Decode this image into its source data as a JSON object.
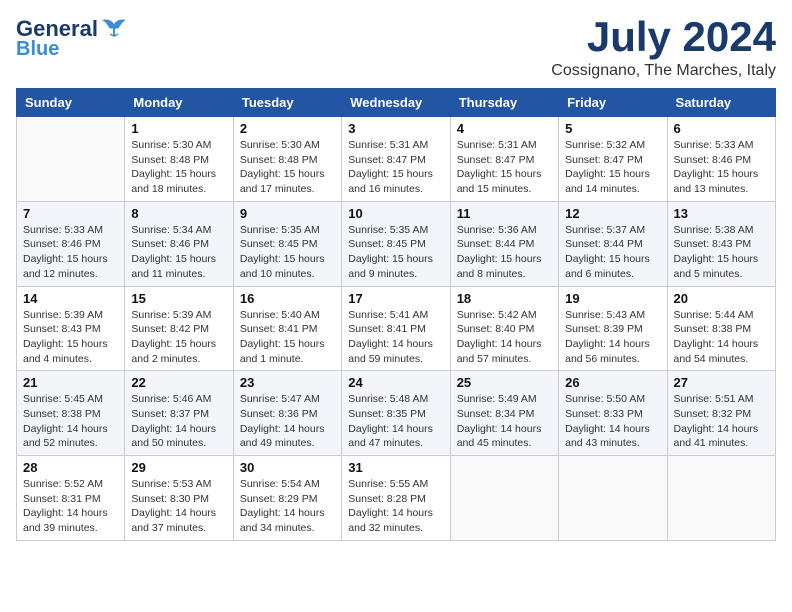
{
  "header": {
    "logo_general": "General",
    "logo_blue": "Blue",
    "month_title": "July 2024",
    "location": "Cossignano, The Marches, Italy"
  },
  "weekdays": [
    "Sunday",
    "Monday",
    "Tuesday",
    "Wednesday",
    "Thursday",
    "Friday",
    "Saturday"
  ],
  "weeks": [
    [
      {
        "day": "",
        "info": ""
      },
      {
        "day": "1",
        "info": "Sunrise: 5:30 AM\nSunset: 8:48 PM\nDaylight: 15 hours\nand 18 minutes."
      },
      {
        "day": "2",
        "info": "Sunrise: 5:30 AM\nSunset: 8:48 PM\nDaylight: 15 hours\nand 17 minutes."
      },
      {
        "day": "3",
        "info": "Sunrise: 5:31 AM\nSunset: 8:47 PM\nDaylight: 15 hours\nand 16 minutes."
      },
      {
        "day": "4",
        "info": "Sunrise: 5:31 AM\nSunset: 8:47 PM\nDaylight: 15 hours\nand 15 minutes."
      },
      {
        "day": "5",
        "info": "Sunrise: 5:32 AM\nSunset: 8:47 PM\nDaylight: 15 hours\nand 14 minutes."
      },
      {
        "day": "6",
        "info": "Sunrise: 5:33 AM\nSunset: 8:46 PM\nDaylight: 15 hours\nand 13 minutes."
      }
    ],
    [
      {
        "day": "7",
        "info": "Sunrise: 5:33 AM\nSunset: 8:46 PM\nDaylight: 15 hours\nand 12 minutes."
      },
      {
        "day": "8",
        "info": "Sunrise: 5:34 AM\nSunset: 8:46 PM\nDaylight: 15 hours\nand 11 minutes."
      },
      {
        "day": "9",
        "info": "Sunrise: 5:35 AM\nSunset: 8:45 PM\nDaylight: 15 hours\nand 10 minutes."
      },
      {
        "day": "10",
        "info": "Sunrise: 5:35 AM\nSunset: 8:45 PM\nDaylight: 15 hours\nand 9 minutes."
      },
      {
        "day": "11",
        "info": "Sunrise: 5:36 AM\nSunset: 8:44 PM\nDaylight: 15 hours\nand 8 minutes."
      },
      {
        "day": "12",
        "info": "Sunrise: 5:37 AM\nSunset: 8:44 PM\nDaylight: 15 hours\nand 6 minutes."
      },
      {
        "day": "13",
        "info": "Sunrise: 5:38 AM\nSunset: 8:43 PM\nDaylight: 15 hours\nand 5 minutes."
      }
    ],
    [
      {
        "day": "14",
        "info": "Sunrise: 5:39 AM\nSunset: 8:43 PM\nDaylight: 15 hours\nand 4 minutes."
      },
      {
        "day": "15",
        "info": "Sunrise: 5:39 AM\nSunset: 8:42 PM\nDaylight: 15 hours\nand 2 minutes."
      },
      {
        "day": "16",
        "info": "Sunrise: 5:40 AM\nSunset: 8:41 PM\nDaylight: 15 hours\nand 1 minute."
      },
      {
        "day": "17",
        "info": "Sunrise: 5:41 AM\nSunset: 8:41 PM\nDaylight: 14 hours\nand 59 minutes."
      },
      {
        "day": "18",
        "info": "Sunrise: 5:42 AM\nSunset: 8:40 PM\nDaylight: 14 hours\nand 57 minutes."
      },
      {
        "day": "19",
        "info": "Sunrise: 5:43 AM\nSunset: 8:39 PM\nDaylight: 14 hours\nand 56 minutes."
      },
      {
        "day": "20",
        "info": "Sunrise: 5:44 AM\nSunset: 8:38 PM\nDaylight: 14 hours\nand 54 minutes."
      }
    ],
    [
      {
        "day": "21",
        "info": "Sunrise: 5:45 AM\nSunset: 8:38 PM\nDaylight: 14 hours\nand 52 minutes."
      },
      {
        "day": "22",
        "info": "Sunrise: 5:46 AM\nSunset: 8:37 PM\nDaylight: 14 hours\nand 50 minutes."
      },
      {
        "day": "23",
        "info": "Sunrise: 5:47 AM\nSunset: 8:36 PM\nDaylight: 14 hours\nand 49 minutes."
      },
      {
        "day": "24",
        "info": "Sunrise: 5:48 AM\nSunset: 8:35 PM\nDaylight: 14 hours\nand 47 minutes."
      },
      {
        "day": "25",
        "info": "Sunrise: 5:49 AM\nSunset: 8:34 PM\nDaylight: 14 hours\nand 45 minutes."
      },
      {
        "day": "26",
        "info": "Sunrise: 5:50 AM\nSunset: 8:33 PM\nDaylight: 14 hours\nand 43 minutes."
      },
      {
        "day": "27",
        "info": "Sunrise: 5:51 AM\nSunset: 8:32 PM\nDaylight: 14 hours\nand 41 minutes."
      }
    ],
    [
      {
        "day": "28",
        "info": "Sunrise: 5:52 AM\nSunset: 8:31 PM\nDaylight: 14 hours\nand 39 minutes."
      },
      {
        "day": "29",
        "info": "Sunrise: 5:53 AM\nSunset: 8:30 PM\nDaylight: 14 hours\nand 37 minutes."
      },
      {
        "day": "30",
        "info": "Sunrise: 5:54 AM\nSunset: 8:29 PM\nDaylight: 14 hours\nand 34 minutes."
      },
      {
        "day": "31",
        "info": "Sunrise: 5:55 AM\nSunset: 8:28 PM\nDaylight: 14 hours\nand 32 minutes."
      },
      {
        "day": "",
        "info": ""
      },
      {
        "day": "",
        "info": ""
      },
      {
        "day": "",
        "info": ""
      }
    ]
  ]
}
